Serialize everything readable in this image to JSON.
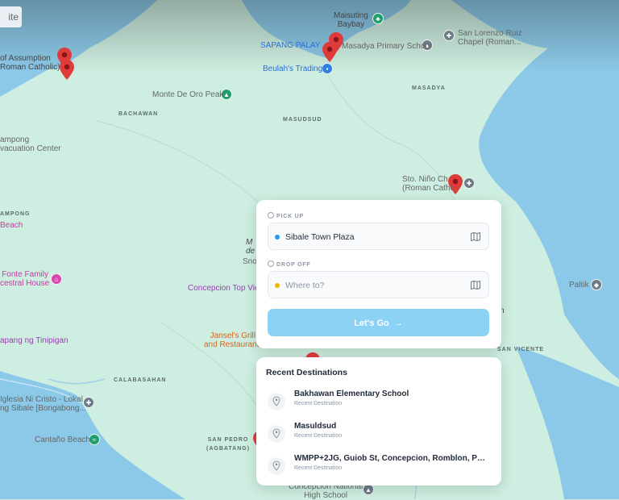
{
  "map": {
    "satellite_label": "ite",
    "labels": {
      "maisuting": "Maisuting\nBaybay",
      "sapang_palay": "SAPANG PALAY",
      "masadya_school": "Masadya Primary School",
      "san_lorenzo": "San Lorenzo Ruiz\nChapel (Roman...",
      "beulahs": "Beulah's Trading",
      "assumption": "of Assumption\nRoman Catholic)",
      "monte_de_oro": "Monte De Oro Peak",
      "bachawan": "BACHAWAN",
      "masudsud_area": "MASUDSUD",
      "masadya_area": "MASADYA",
      "evac": "ampong\nvacuation Center",
      "sto_nino": "Sto. Niño Ch\n(Roman Catho",
      "ampong": "AMPONG",
      "beach": "Beach",
      "fonte": "Fonte Family\ncestral House",
      "m_de": "M\nde",
      "snow": "Snov",
      "concepcion_top": "Concepcion Top Vie",
      "paltik": "Paltik",
      "n_frag": "n",
      "jansels": "Jansel's Grill\nand Restaurant",
      "san_vicente": "SAN VICENTE",
      "tinipigan": "apang ng Tinipigan",
      "calabasahan": "CALABASAHAN",
      "iglesia": "Iglesia Ni Cristo - Lokal\nng Sibale [Bongabong...",
      "cantano": "Cantaño Beach",
      "san_pedro": "SAN PEDRO\n(AGBATANG)",
      "concepcion_hs": "Concepcion National\nHigh School"
    }
  },
  "trip": {
    "pickup_label": "PICK UP",
    "pickup_value": "Sibale Town Plaza",
    "pickup_dot_color": "#1e9af0",
    "dropoff_label": "DROP OFF",
    "dropoff_placeholder": "Where to?",
    "dropoff_dot_color": "#f5b400",
    "go_label": "Let's Go"
  },
  "recent": {
    "title": "Recent Destinations",
    "items": [
      {
        "name": "Bakhawan Elementary School",
        "sub": "Recent Destination"
      },
      {
        "name": "Masuldsud",
        "sub": "Recent Destination"
      },
      {
        "name": "WMPP+2JG, Guiob St, Concepcion, Romblon, Phili...",
        "sub": "Recent Destination"
      }
    ]
  },
  "colors": {
    "land": "#cdeee0",
    "water": "#8cc9e8",
    "accent_button": "#8bd2f4",
    "pin_red": "#e03b3b"
  }
}
